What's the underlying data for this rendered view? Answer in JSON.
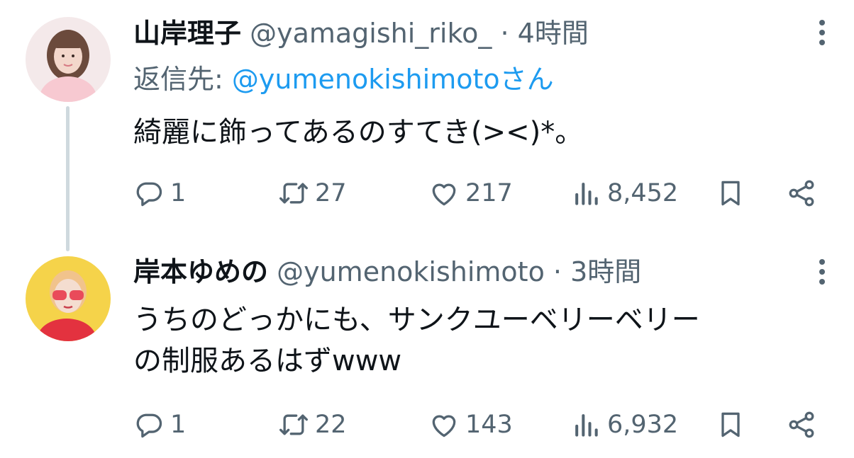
{
  "tweets": [
    {
      "name": "山岸理子",
      "handle": "@yamagishi_riko_",
      "separator": "·",
      "time": "4時間",
      "reply_prefix": "返信先: ",
      "reply_handle": "@yumenokishimoto",
      "reply_suffix": "さん",
      "text_lines": [
        "綺麗に飾ってあるのすてき(><)*。"
      ],
      "stats": {
        "replies": "1",
        "retweets": "27",
        "likes": "217",
        "views": "8,452"
      }
    },
    {
      "name": "岸本ゆめの",
      "handle": "@yumenokishimoto",
      "separator": "·",
      "time": "3時間",
      "text_lines": [
        "うちのどっかにも、サンクユーベリーベリー",
        "の制服あるはずwww"
      ],
      "stats": {
        "replies": "1",
        "retweets": "22",
        "likes": "143",
        "views": "6,932"
      }
    }
  ],
  "icons": {
    "reply": "reply-icon",
    "retweet": "retweet-icon",
    "like": "heart-icon",
    "views": "views-icon",
    "bookmark": "bookmark-icon",
    "share": "share-icon",
    "more": "more-icon"
  },
  "colors": {
    "text": "#0f1419",
    "secondary": "#536471",
    "link": "#1d9bf0",
    "thread_line": "#cfd9de"
  }
}
